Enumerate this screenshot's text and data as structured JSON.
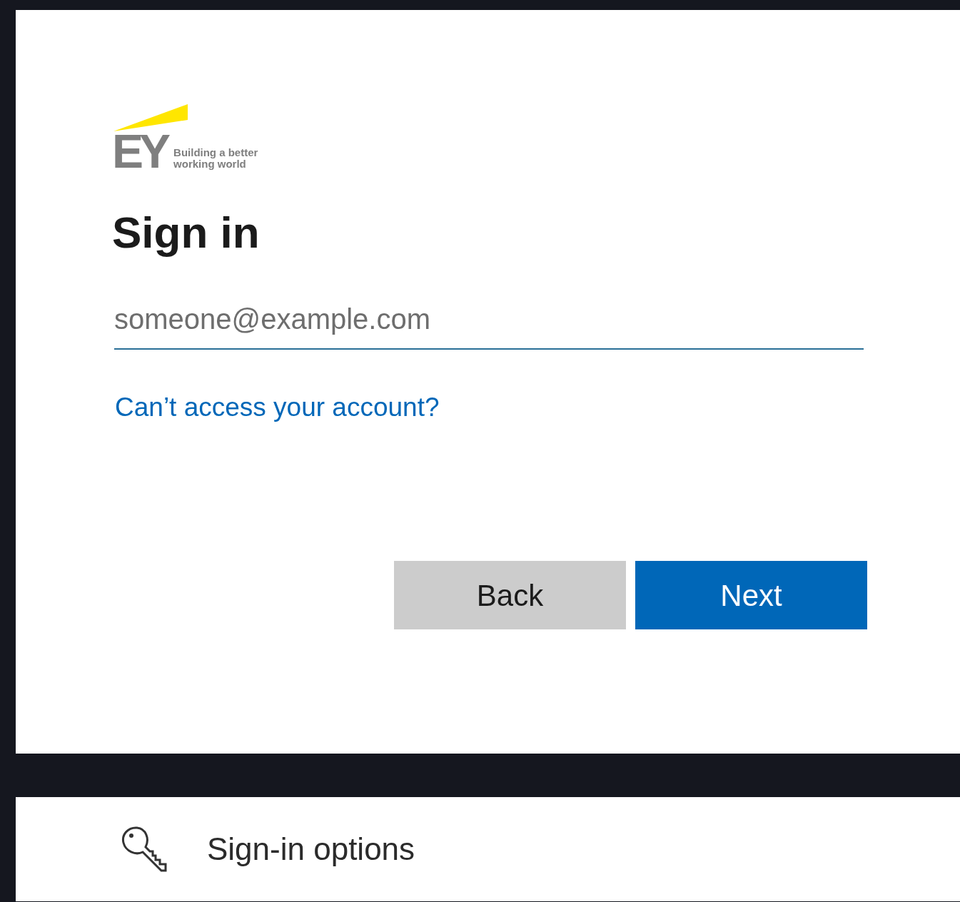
{
  "logo": {
    "mark": "EY",
    "tagline": [
      "Building a better",
      "working world"
    ]
  },
  "title": "Sign in",
  "email_field": {
    "placeholder": "someone@example.com"
  },
  "help_link": "Can’t access your account?",
  "buttons": [
    {
      "label": "Back",
      "kind": "secondary"
    },
    {
      "label": "Next",
      "kind": "primary"
    }
  ],
  "sign_in_options": {
    "label": "Sign-in options"
  }
}
